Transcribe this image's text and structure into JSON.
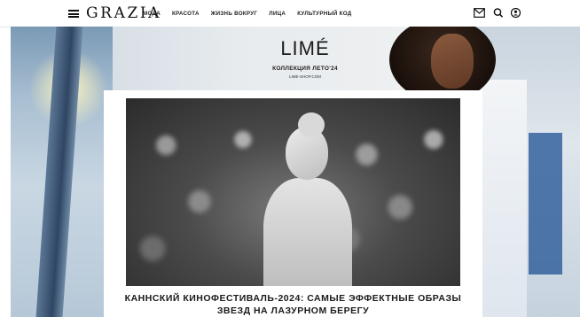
{
  "header": {
    "logo": "GRAZIA",
    "nav": [
      "МОДА",
      "КРАСОТА",
      "ЖИЗНЬ ВОКРУГ",
      "ЛИЦА",
      "КУЛЬТУРНЫЙ КОД"
    ],
    "icons": [
      "menu-icon",
      "mail-icon",
      "search-icon",
      "user-icon"
    ]
  },
  "ad": {
    "brand": "LIMÉ",
    "collection": "КОЛЛЕКЦИЯ ЛЕТО'24",
    "site": "LIME-SHOP.COM"
  },
  "article": {
    "headline_line1": "КАННСКИЙ КИНОФЕСТИВАЛЬ-2024: САМЫЕ ЭФФЕКТНЫЕ ОБРАЗЫ",
    "headline_line2": "ЗВЕЗД НА ЛАЗУРНОМ БЕРЕГУ"
  }
}
